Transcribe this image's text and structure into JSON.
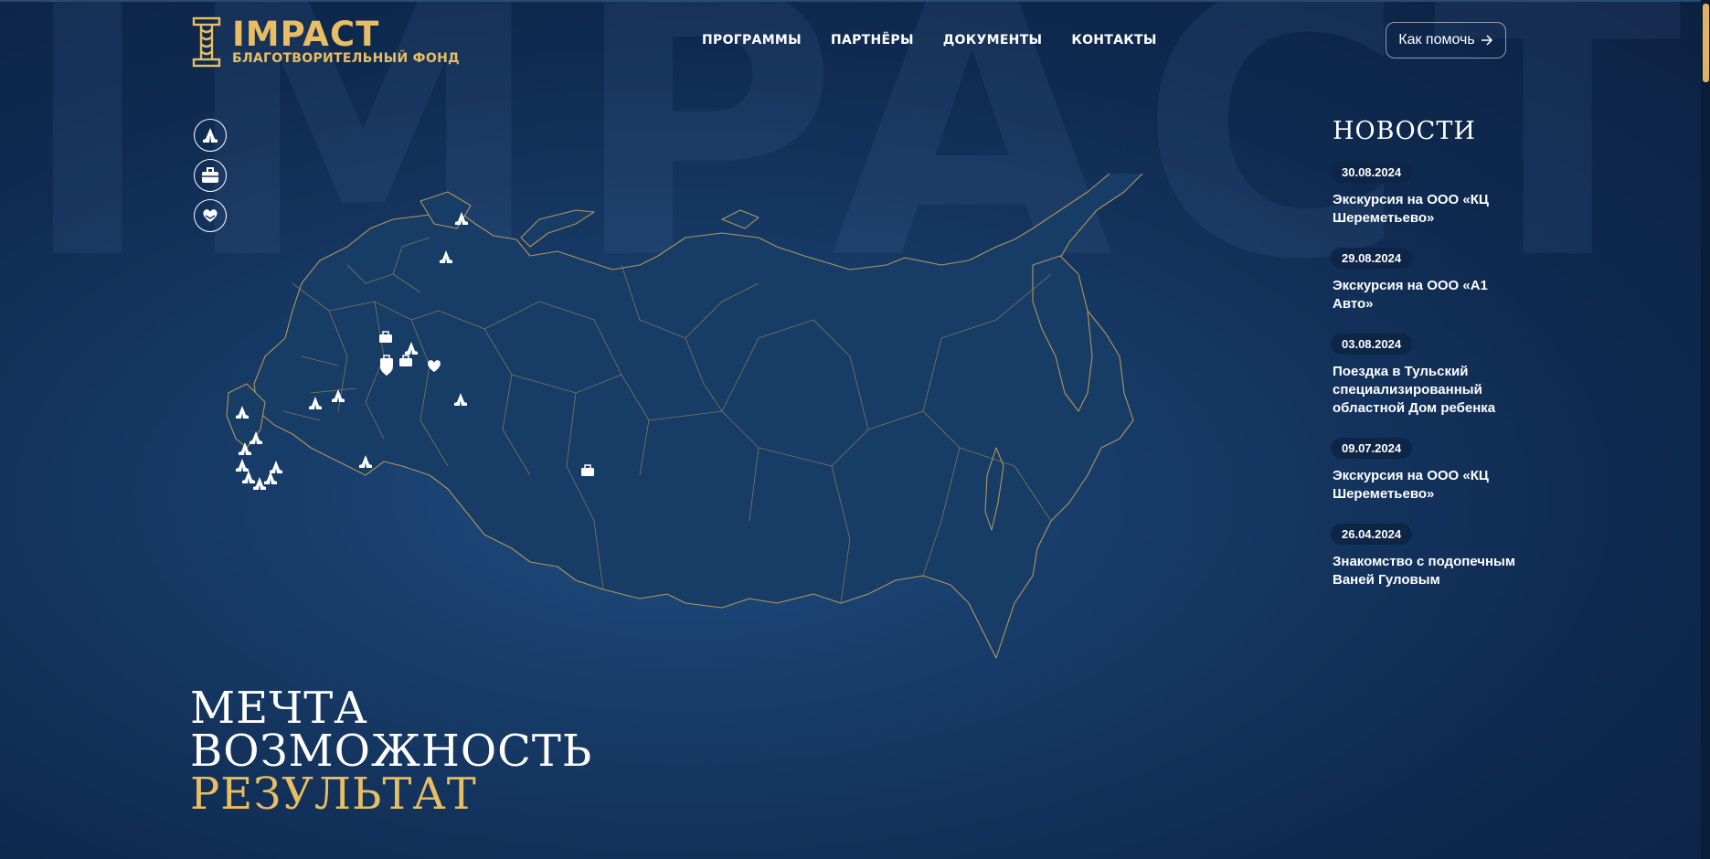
{
  "brand": {
    "name": "IMPACT",
    "subtitle": "БЛАГОТВОРИТЕЛЬНЫЙ ФОНД",
    "background_word": "IMPACT",
    "accent_color": "#e8bd63"
  },
  "nav": {
    "items": [
      "ПРОГРАММЫ",
      "ПАРТНЁРЫ",
      "ДОКУМЕНТЫ",
      "КОНТАКТЫ"
    ]
  },
  "help_button": {
    "label": "Как помочь",
    "icon": "arrow-right-icon"
  },
  "side_icons": [
    "praying-hands-icon",
    "briefcase-icon",
    "heart-hands-icon"
  ],
  "news": {
    "title": "НОВОСТИ",
    "items": [
      {
        "date": "30.08.2024",
        "text": "Экскурсия на ООО «КЦ Шереметьево»"
      },
      {
        "date": "29.08.2024",
        "text": "Экскурсия на ООО «А1 Авто»"
      },
      {
        "date": "03.08.2024",
        "text": "Поездка в Тульский специализированный областной Дом ребенка"
      },
      {
        "date": "09.07.2024",
        "text": "Экскурсия на ООО «КЦ Шереметьево»"
      },
      {
        "date": "26.04.2024",
        "text": "Знакомство с подопечным Ваней Гуловым"
      }
    ]
  },
  "slogan": {
    "line1": "МЕЧТА",
    "line2": "ВОЗМОЖНОСТЬ",
    "line3": "РЕЗУЛЬТАТ"
  }
}
